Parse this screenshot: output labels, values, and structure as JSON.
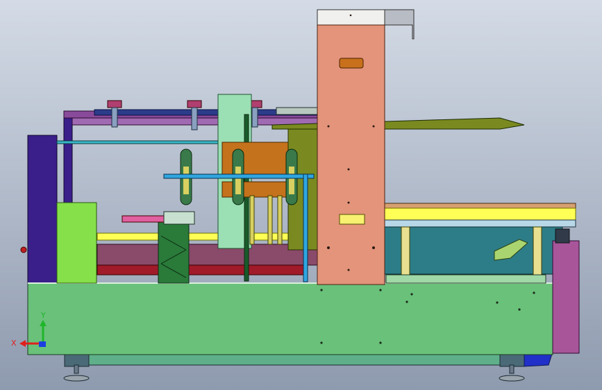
{
  "viewport": {
    "background_top": "#d4dbe6",
    "background_bottom": "#8e9aae"
  },
  "triad": {
    "x_label": "X",
    "y_label": "Y",
    "x_color": "#e0201c",
    "y_color": "#1fb62a",
    "z_color": "#1c3ee0"
  },
  "colors": {
    "base_frame": "#6ac17a",
    "tower": "#e3947a",
    "tower_cap": "#f0f0ee",
    "purple_post": "#3a1e8a",
    "lime_box": "#86e04a",
    "magenta_panel": "#a8559a",
    "teal_tray": "#2d7d88",
    "yellow_shelf": "#ffff55",
    "orange_block": "#c4721c",
    "cyan_rod": "#2fa6e0",
    "dark_green_stand": "#2a7a3a",
    "red_rail": "#a01a2a",
    "navy_beam": "#2b3c8a",
    "olive_plate": "#7a8a20",
    "mint_plate": "#9ae0b4"
  }
}
